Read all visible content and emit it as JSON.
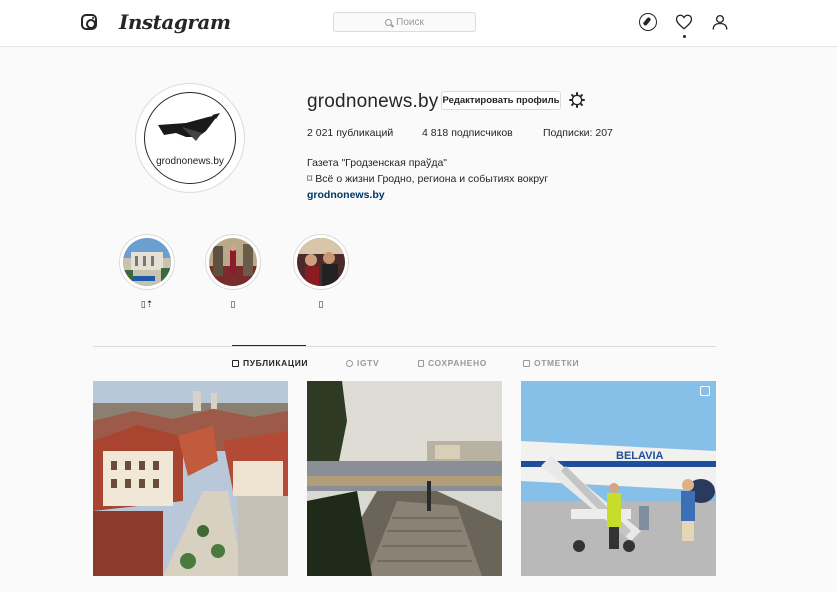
{
  "header": {
    "wordmark": "Instagram",
    "search_placeholder": "Поиск",
    "icons": [
      "instagram-glyph-icon",
      "compass-icon",
      "heart-icon",
      "person-icon"
    ]
  },
  "profile": {
    "avatar_text": "grodnonews.by",
    "username": "grodnonews.by",
    "edit_button": "Редактировать профиль",
    "stats": {
      "posts": "2 021 публикаций",
      "followers": "4 818 подписчиков",
      "following": "Подписки: 207"
    },
    "bio": {
      "name": "Газета \"Гродзенская праўда\"",
      "description": "⌑ Всё о жизни Гродно, региона и событиях вокруг",
      "link": "grodnonews.by"
    }
  },
  "highlights": [
    {
      "label": "▯⇡"
    },
    {
      "label": "▯"
    },
    {
      "label": "▯"
    }
  ],
  "tabs": [
    {
      "label": "ПУБЛИКАЦИИ",
      "icon": "grid-icon"
    },
    {
      "label": "IGTV",
      "icon": "igtv-icon"
    },
    {
      "label": "СОХРАНЕНО",
      "icon": "bookmark-icon"
    },
    {
      "label": "ОТМЕТКИ",
      "icon": "tag-icon"
    }
  ],
  "posts": [
    {
      "subject": "city-rooftops"
    },
    {
      "subject": "river-stairs"
    },
    {
      "subject": "airplane-passengers",
      "multi": true
    }
  ],
  "colors": {
    "link": "#003569",
    "border": "#dbdbdb",
    "text": "#262626",
    "muted": "#999999"
  }
}
